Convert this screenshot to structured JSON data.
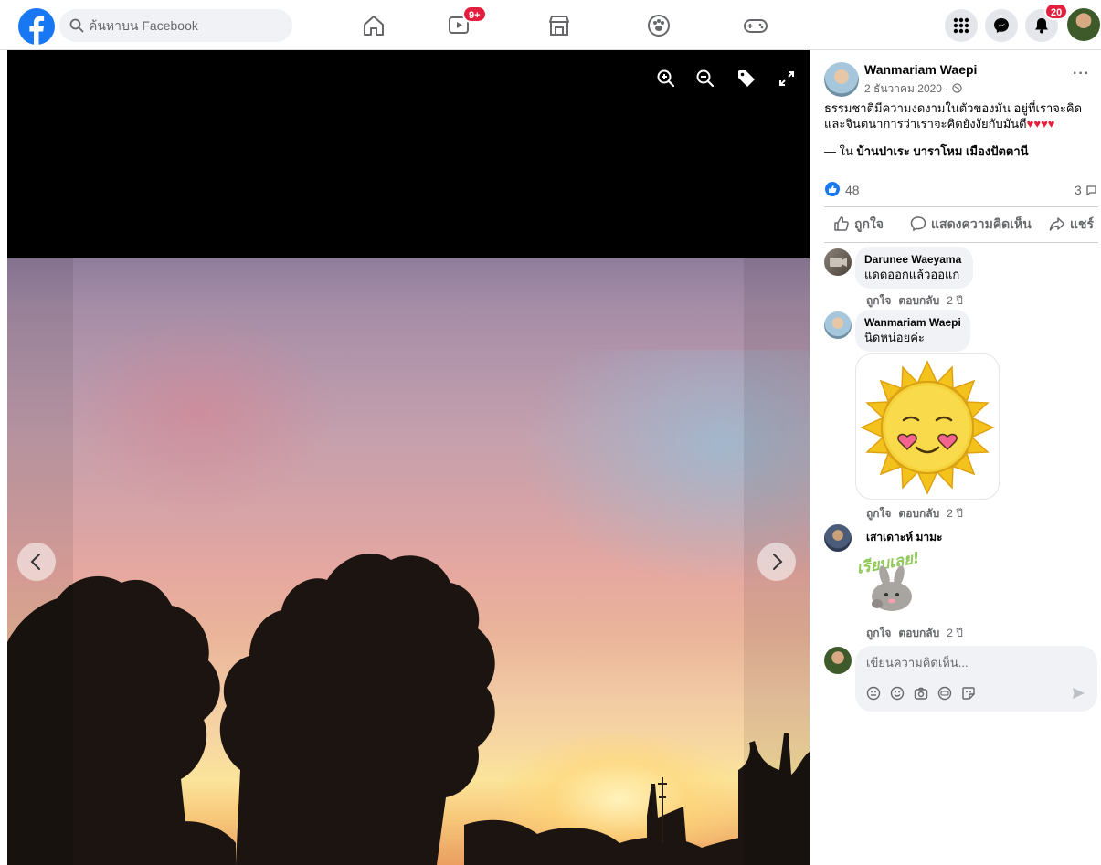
{
  "topbar": {
    "search_placeholder": "ค้นหาบน Facebook",
    "watch_badge": "9+",
    "notif_badge": "20",
    "brand_color": "#1877f2"
  },
  "viewer": {
    "tools": [
      "zoom-in-icon",
      "zoom-out-icon",
      "tag-icon",
      "fullscreen-icon"
    ]
  },
  "post": {
    "author": "Wanmariam Waepi",
    "date": "2 ธันวาคม 2020 · ",
    "text": "ธรรมชาติมีความงดงามในตัวของมัน อยู่ที่เราจะคิดและจินตนาการว่าเราจะคิดยังงัยกับมันดี",
    "text_hearts": "♥♥♥♥",
    "checkin_prefix": "— ใน ",
    "checkin_place": "บ้านปาเระ บาราโหม เมืองปัตตานี",
    "like_count": "48",
    "comment_count": "3",
    "actions": {
      "like": "ถูกใจ",
      "comment": "แสดงความคิดเห็น",
      "share": "แชร์"
    },
    "more": "···"
  },
  "comments": [
    {
      "name": "Darunee Waeyama",
      "text": "แดดออกแล้วออแก",
      "like": "ถูกใจ",
      "reply": "ตอบกลับ",
      "time": "2 ปี"
    },
    {
      "name": "Wanmariam Waepi",
      "text": "นิดหน่อยค่ะ",
      "like": "ถูกใจ",
      "reply": "ตอบกลับ",
      "time": "2 ปี"
    },
    {
      "name": "เสาเดาะห์ มามะ",
      "sticker_text": "เรียบเลย!",
      "like": "ถูกใจ",
      "reply": "ตอบกลับ",
      "time": "2 ปี"
    }
  ],
  "composer": {
    "placeholder": "เขียนความคิดเห็น..."
  }
}
